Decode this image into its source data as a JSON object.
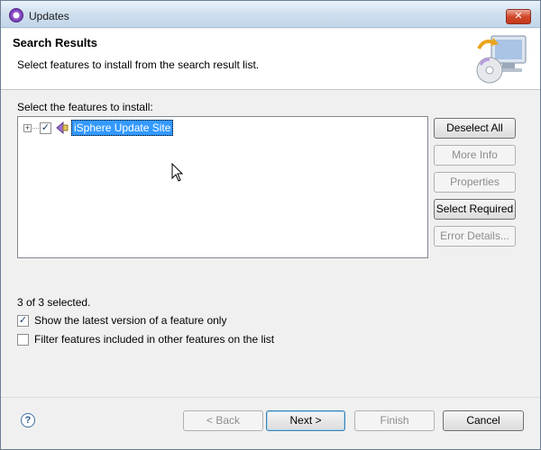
{
  "window": {
    "title": "Updates",
    "close_label": "✕"
  },
  "header": {
    "title": "Search Results",
    "description": "Select features to install from the search result list."
  },
  "tree": {
    "label": "Select the features to install:",
    "items": [
      {
        "label": "iSphere Update Site",
        "checked": true,
        "selected": true,
        "expander": "+"
      }
    ]
  },
  "side_buttons": {
    "deselect_all": "Deselect All",
    "more_info": "More Info",
    "properties": "Properties",
    "select_required": "Select Required",
    "error_details": "Error Details..."
  },
  "status": "3 of 3 selected.",
  "options": {
    "latest_version": {
      "label": "Show the latest version of a feature only",
      "checked": true
    },
    "filter_features": {
      "label": "Filter features included in other features on the list",
      "checked": false
    }
  },
  "footer": {
    "help": "?",
    "back": "< Back",
    "next": "Next >",
    "finish": "Finish",
    "cancel": "Cancel"
  },
  "colors": {
    "selection": "#3399ff",
    "title_bar": "#cfdfee"
  }
}
